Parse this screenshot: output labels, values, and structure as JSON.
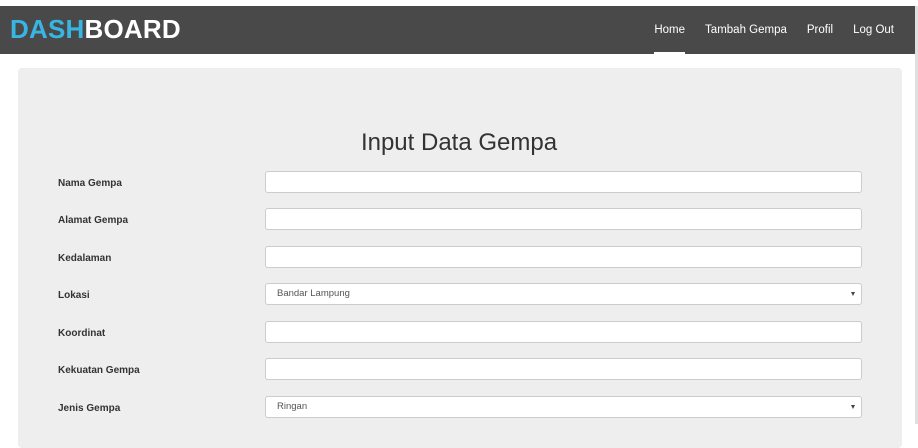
{
  "brand": {
    "dash": "DASH",
    "board": "BOARD"
  },
  "nav": {
    "items": [
      "Home",
      "Tambah Gempa",
      "Profil",
      "Log Out"
    ],
    "active": "Home"
  },
  "form": {
    "title": "Input Data Gempa",
    "fields": [
      {
        "label": "Nama Gempa",
        "value": ""
      },
      {
        "label": "Alamat Gempa",
        "value": ""
      },
      {
        "label": "Kedalaman",
        "value": ""
      },
      {
        "label": "Lokasi",
        "value": "Bandar Lampung",
        "type": "select"
      },
      {
        "label": "Koordinat",
        "value": ""
      },
      {
        "label": "Kekuatan Gempa",
        "value": ""
      },
      {
        "label": "Jenis Gempa",
        "value": "Ringan",
        "type": "select"
      }
    ]
  },
  "colors": {
    "navbar": "#494949",
    "brand_accent": "#38b6e3",
    "panel": "#eeeeee"
  }
}
